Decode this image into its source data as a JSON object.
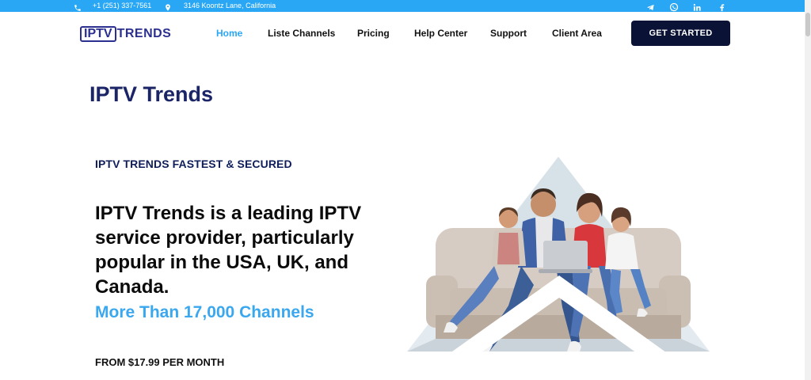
{
  "topbar": {
    "phone": "+1 (251) 337-7561",
    "address": "3146 Koontz Lane, California",
    "background": "#2aa7f4",
    "icons": [
      "phone-icon",
      "location-pin-icon",
      "telegram-icon",
      "whatsapp-icon",
      "linkedin-icon",
      "facebook-icon"
    ]
  },
  "header": {
    "logo": {
      "boxed": "IPTV",
      "rest": "TRENDS",
      "color": "#2b2f8f"
    },
    "nav": [
      {
        "label": "Home",
        "active": true
      },
      {
        "label": "Liste Channels",
        "active": false
      },
      {
        "label": "Pricing",
        "active": false
      },
      {
        "label": "Help Center",
        "active": false
      },
      {
        "label": "Support",
        "active": false
      },
      {
        "label": "Client Area",
        "active": false
      }
    ],
    "cta_label": "GET STARTED",
    "cta_color": "#0a1235",
    "active_color": "#2aa7f4"
  },
  "main": {
    "page_title": "IPTV Trends",
    "eyebrow": "IPTV TRENDS FASTEST & SECURED",
    "headline": "IPTV Trends is a leading IPTV service provider, particularly popular in the USA, UK, and Canada.",
    "subhead": "More Than 17,000 Channels",
    "subhead_color": "#3aa7ee",
    "price": "FROM $17.99 PER MONTH"
  }
}
